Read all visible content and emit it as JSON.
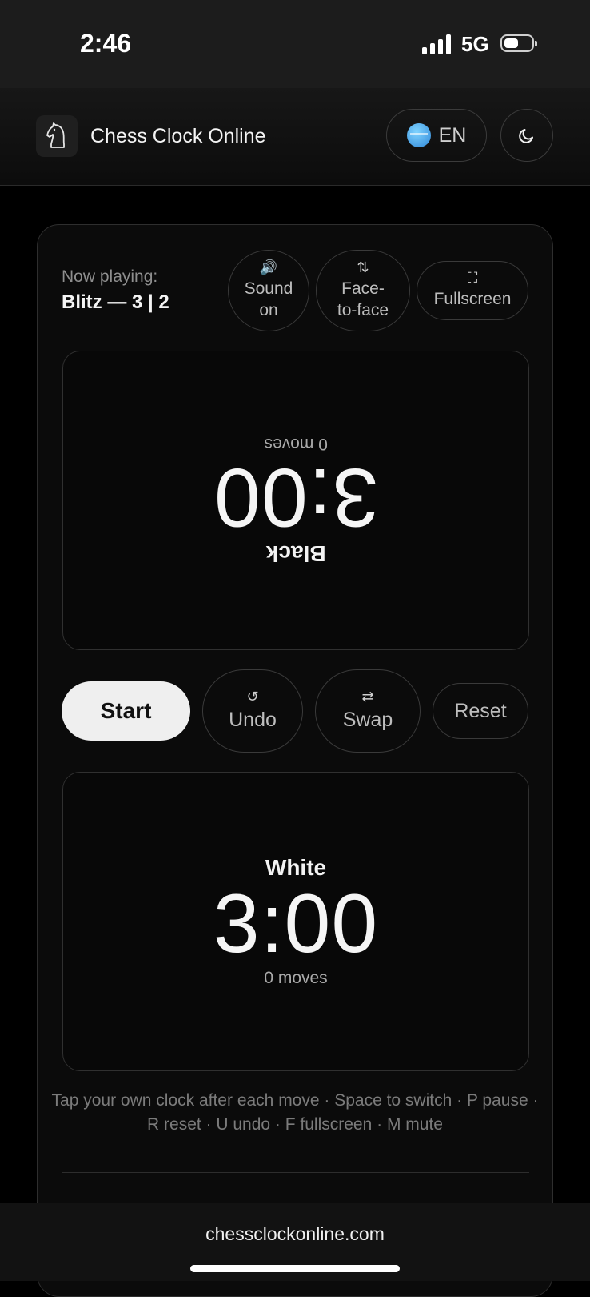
{
  "status_bar": {
    "time": "2:46",
    "network": "5G"
  },
  "header": {
    "title": "Chess Clock Online",
    "language": "EN"
  },
  "game": {
    "now_playing_label": "Now playing:",
    "mode": "Blitz — 3 | 2"
  },
  "toolbar": {
    "sound_line1": "Sound",
    "sound_line2": "on",
    "face_line1": "Face-",
    "face_line2": "to-face",
    "fullscreen": "Fullscreen"
  },
  "black": {
    "name": "Black",
    "time": "3:00",
    "moves": "0 moves"
  },
  "white": {
    "name": "White",
    "time": "3:00",
    "moves": "0 moves"
  },
  "controls": {
    "start": "Start",
    "undo": "Undo",
    "swap": "Swap",
    "reset": "Reset"
  },
  "hint": "Tap your own clock after each move · Space to switch · P pause · R reset · U undo · F fullscreen · M mute",
  "browser": {
    "url": "chessclockonline.com"
  }
}
